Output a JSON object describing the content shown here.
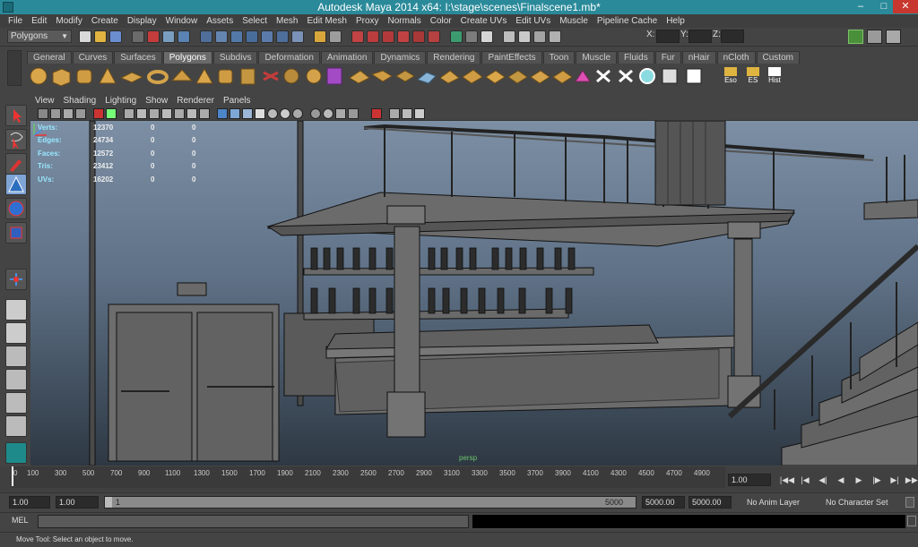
{
  "window": {
    "title": "Autodesk Maya 2014 x64: I:\\stage\\scenes\\Finalscene1.mb*"
  },
  "menu": [
    "File",
    "Edit",
    "Modify",
    "Create",
    "Display",
    "Window",
    "Assets",
    "Select",
    "Mesh",
    "Edit Mesh",
    "Proxy",
    "Normals",
    "Color",
    "Create UVs",
    "Edit UVs",
    "Muscle",
    "Pipeline Cache",
    "Help"
  ],
  "status_line": {
    "mode": "Polygons",
    "x_label": "X:",
    "y_label": "Y:",
    "z_label": "Z:"
  },
  "shelf": {
    "tabs": [
      "General",
      "Curves",
      "Surfaces",
      "Polygons",
      "Subdivs",
      "Deformation",
      "Animation",
      "Dynamics",
      "Rendering",
      "PaintEffects",
      "Toon",
      "Muscle",
      "Fluids",
      "Fur",
      "nHair",
      "nCloth",
      "Custom"
    ],
    "active_tab": "Polygons",
    "text_buttons": [
      "Eso",
      "ES",
      "Hist"
    ]
  },
  "panel_menu": [
    "View",
    "Shading",
    "Lighting",
    "Show",
    "Renderer",
    "Panels"
  ],
  "hud": {
    "rows": [
      {
        "label": "Verts:",
        "v1": "12370",
        "v2": "0",
        "v3": "0"
      },
      {
        "label": "Edges:",
        "v1": "24734",
        "v2": "0",
        "v3": "0"
      },
      {
        "label": "Faces:",
        "v1": "12572",
        "v2": "0",
        "v3": "0"
      },
      {
        "label": "Tris:",
        "v1": "23412",
        "v2": "0",
        "v3": "0"
      },
      {
        "label": "UVs:",
        "v1": "16202",
        "v2": "0",
        "v3": "0"
      }
    ],
    "camera": "persp"
  },
  "timeline": {
    "ticks": [
      "0",
      "100",
      "300",
      "500",
      "700",
      "900",
      "1100",
      "1300",
      "1500",
      "1700",
      "1900",
      "2100",
      "2300",
      "2500",
      "2700",
      "2900",
      "3100",
      "3300",
      "3500",
      "3700",
      "3900",
      "4100",
      "4300",
      "4500",
      "4700",
      "4900"
    ],
    "current_frame": "1.00"
  },
  "range": {
    "start": "1.00",
    "playback_start": "1.00",
    "slider_start": "1",
    "slider_end": "5000",
    "playback_end": "5000.00",
    "end": "5000.00",
    "anim_layer": "No Anim Layer",
    "character_set": "No Character Set"
  },
  "command": {
    "label": "MEL"
  },
  "help": {
    "text": "Move Tool: Select an object to move."
  },
  "colors": {
    "title_bar": "#2a8a9a",
    "hud_label": "#98e7ff",
    "viewport_top": "#7c8fa4",
    "viewport_bottom": "#2e3843"
  }
}
